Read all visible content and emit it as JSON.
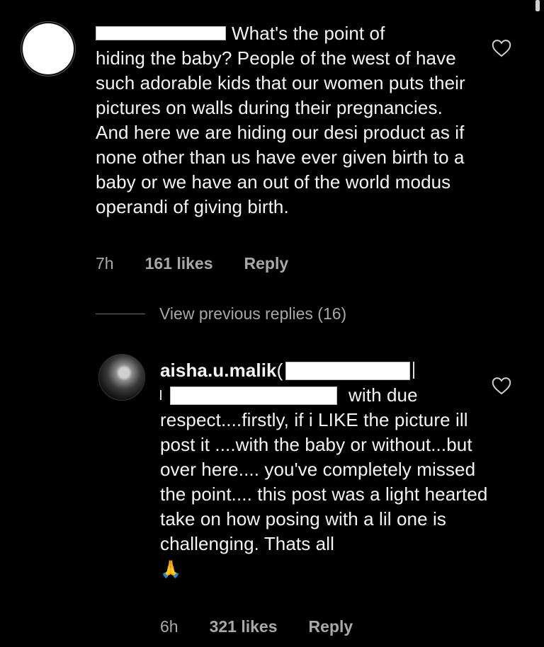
{
  "comment1": {
    "line1": "What's the point of",
    "body": "hiding the baby? People of the west of have such adorable kids that our women puts their pictures on walls during their pregnancies. And here we are hiding our desi product as if none other than us have ever given birth to a baby or we have an out of the world modus operandi of giving birth.",
    "time": "7h",
    "likes": "161 likes",
    "reply": "Reply"
  },
  "view_previous": "View previous replies (16)",
  "comment2": {
    "username": "aisha.u.malik",
    "paren": "(",
    "line2_tail": "with due",
    "body": "respect....firstly, if i LIKE the picture ill post it ....with the baby or without...but over here.... you've completely missed the point.... this post was a light hearted take on how posing with a lil one is challenging. Thats all",
    "emoji": "🙏",
    "time": "6h",
    "likes": "321 likes",
    "reply": "Reply"
  },
  "icons": {
    "like": "heart-outline-icon",
    "pray": "folded-hands-emoji"
  },
  "colors": {
    "background": "#000000",
    "text": "#f4f4f4",
    "meta": "#a8a8a8"
  }
}
